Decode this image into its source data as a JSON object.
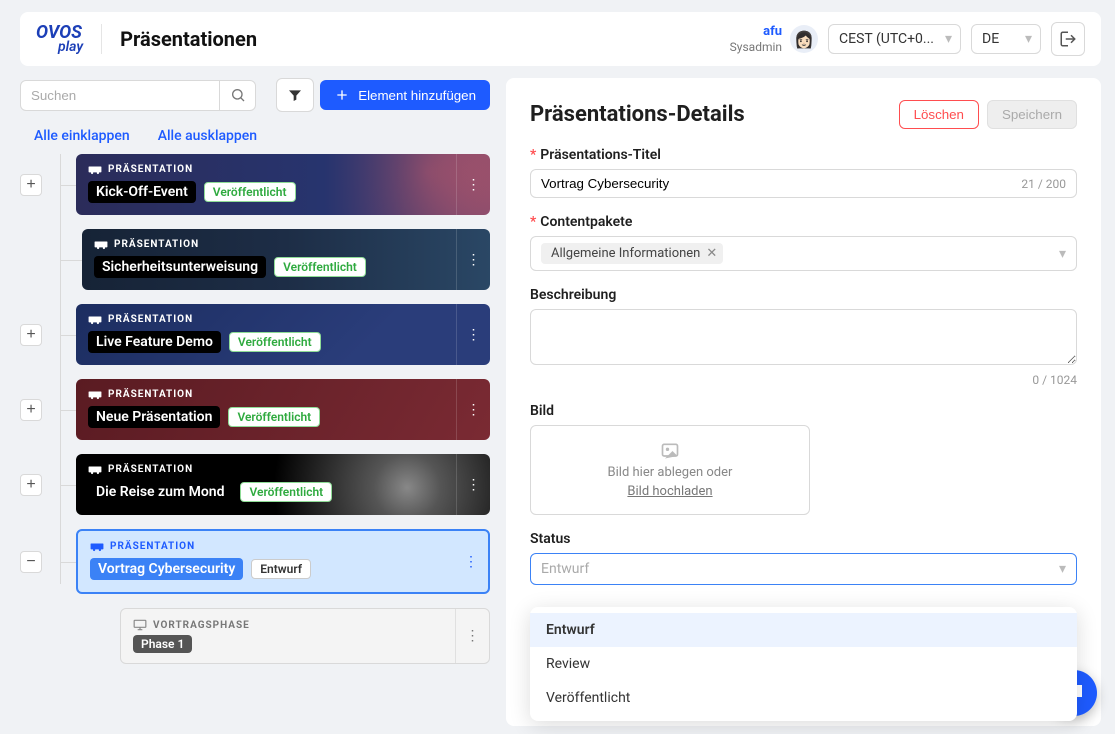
{
  "app": {
    "logo_line1": "OVOS",
    "logo_line2": "play",
    "page_title": "Präsentationen"
  },
  "header": {
    "user_name": "afu",
    "user_role": "Sysadmin",
    "tz_selected": "CEST (UTC+0...",
    "lang_selected": "DE"
  },
  "left": {
    "search_placeholder": "Suchen",
    "add_label": "Element hinzufügen",
    "collapse_all": "Alle einklappen",
    "expand_all": "Alle ausklappen",
    "type_label": "PRÄSENTATION",
    "phase_type_label": "VORTRAGSPHASE",
    "status_published": "Veröffentlicht",
    "status_draft": "Entwurf",
    "items": [
      {
        "title": "Kick-Off-Event",
        "status": "published"
      },
      {
        "title": "Sicherheitsunterweisung",
        "status": "published"
      },
      {
        "title": "Live Feature Demo",
        "status": "published"
      },
      {
        "title": "Neue Präsentation",
        "status": "published"
      },
      {
        "title": "Die Reise zum Mond",
        "status": "published"
      },
      {
        "title": "Vortrag Cybersecurity",
        "status": "draft"
      }
    ],
    "phase_title": "Phase 1"
  },
  "panel": {
    "title": "Präsentations-Details",
    "delete": "Löschen",
    "save": "Speichern",
    "field_title_label": "Präsentations-Titel",
    "field_title_value": "Vortrag Cybersecurity",
    "field_title_count": "21 / 200",
    "packages_label": "Contentpakete",
    "packages_tag": "Allgemeine Informationen",
    "description_label": "Beschreibung",
    "description_value": "",
    "description_count": "0 / 1024",
    "image_label": "Bild",
    "image_drop_text": "Bild hier ablegen oder",
    "image_upload_link": "Bild hochladen",
    "status_label": "Status",
    "status_value": "Entwurf",
    "status_options": [
      "Entwurf",
      "Review",
      "Veröffentlicht"
    ]
  }
}
